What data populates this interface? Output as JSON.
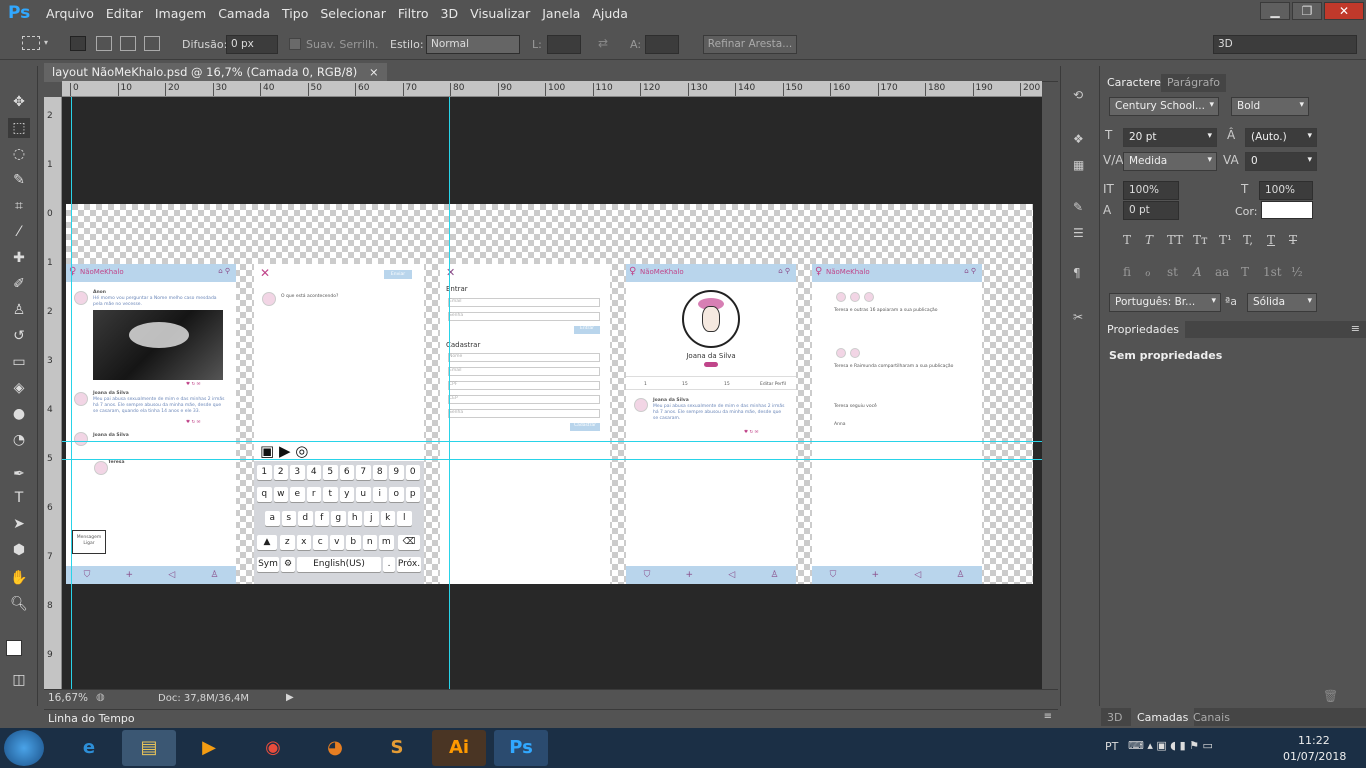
{
  "app": {
    "logo": "Ps",
    "accent": "#31a8ff"
  },
  "menu": [
    "Arquivo",
    "Editar",
    "Imagem",
    "Camada",
    "Tipo",
    "Selecionar",
    "Filtro",
    "3D",
    "Visualizar",
    "Janela",
    "Ajuda"
  ],
  "window_controls": {
    "minimize": "▁",
    "restore": "❐",
    "close": "✕"
  },
  "options": {
    "difusao_label": "Difusão:",
    "difusao_value": "0 px",
    "suav_label": "Suav. Serrilh.",
    "estilo_label": "Estilo:",
    "estilo_value": "Normal",
    "l_label": "L:",
    "a_label": "A:",
    "refinar": "Refinar Aresta...",
    "workspace": "3D"
  },
  "document": {
    "tab_title": "layout NãoMeKhalo.psd @ 16,7% (Camada 0, RGB/8)",
    "close": "×",
    "zoom": "16,67%",
    "doc_size": "Doc: 37,8M/36,4M"
  },
  "ruler_h": [
    "0",
    "10",
    "20",
    "30",
    "40",
    "50",
    "60",
    "70",
    "80",
    "90",
    "100",
    "110",
    "120",
    "130",
    "140",
    "150",
    "160",
    "170",
    "180",
    "190",
    "200"
  ],
  "ruler_v": [
    "2",
    "1",
    "0",
    "1",
    "2",
    "3",
    "4",
    "5",
    "6",
    "7",
    "8",
    "9"
  ],
  "timeline": {
    "label": "Linha do Tempo"
  },
  "mockups": {
    "brand": "NãoMeKhalo",
    "screen1": {
      "post1_name": "Anon",
      "post1_text": "Hé momo vou perguntar a Nome melho caso mesdada pela mãe no vecesse.",
      "post2_name": "Joana da Silva",
      "post2_text": "Meu pai abusa sexualmente de mim e das minhas 2 irmãs há 7 anos. Ele sempre abusou da minha mãe, desde que se casaram, quando ela tinha 14 anos e ele 33.",
      "post3_name": "Joana da Silva",
      "post4_name": "Teresa",
      "bubble": "Mensagem",
      "bubble2": "Ligar"
    },
    "screen2": {
      "send": "Enviar",
      "prompt": "O que está acontecendo?"
    },
    "keyboard": {
      "row0": [
        "1",
        "2",
        "3",
        "4",
        "5",
        "6",
        "7",
        "8",
        "9",
        "0"
      ],
      "row1": [
        "q",
        "w",
        "e",
        "r",
        "t",
        "y",
        "u",
        "i",
        "o",
        "p"
      ],
      "row2": [
        "a",
        "s",
        "d",
        "f",
        "g",
        "h",
        "j",
        "k",
        "l"
      ],
      "row3": [
        "z",
        "x",
        "c",
        "v",
        "b",
        "n",
        "m"
      ],
      "sym": "Sym",
      "lang": "English(US)",
      "next": "Próx."
    },
    "screen3": {
      "login_title": "Entrar",
      "email": "Email",
      "senha": "Senha",
      "entrar_btn": "Entrar",
      "signup_title": "Cadastrar",
      "nome": "Nome",
      "cpf": "CPF",
      "cep": "CEP",
      "confirm": "Cadastrar"
    },
    "screen4": {
      "profile_name": "Joana da Silva",
      "stats": [
        "1",
        "15",
        "15"
      ],
      "edit": "Editar Perfil",
      "post_name": "Joana da Silva",
      "post_text": "Meu pai abusa sexualmente de mim e das minhas 2 irmãs há 7 anos. Ele sempre abusou da minha mãe, desde que se casaram."
    },
    "screen5": {
      "n1": "Teresa e outras 16 apoiaram a sua publicação",
      "n2": "Teresa e Raimunda compartilharam a sua publicação",
      "n3": "Teresa seguiu você",
      "n4": "Anna"
    }
  },
  "character_panel": {
    "tabs": [
      "Caractere",
      "Parágrafo"
    ],
    "font": "Century School...",
    "style": "Bold",
    "size": "20 pt",
    "leading": "(Auto.)",
    "kerning": "Medida",
    "tracking": "0",
    "vscale": "100%",
    "hscale": "100%",
    "baseline": "0 pt",
    "color_label": "Cor:",
    "color": "#ffffff",
    "style_buttons": [
      "T",
      "T",
      "TT",
      "Tт",
      "T¹",
      "T,",
      "T",
      "T"
    ],
    "ot_buttons": [
      "fi",
      "ℴ",
      "st",
      "A",
      "aa",
      "T",
      "1st",
      "½"
    ],
    "language": "Português: Br...",
    "aa_label": "a",
    "antialias": "Sólida"
  },
  "properties_panel": {
    "tab": "Propriedades",
    "content": "Sem propriedades"
  },
  "bottom_tabs": [
    "3D",
    "Camadas",
    "Canais"
  ],
  "taskbar": {
    "lang": "PT",
    "time": "11:22",
    "date": "01/07/2018"
  }
}
